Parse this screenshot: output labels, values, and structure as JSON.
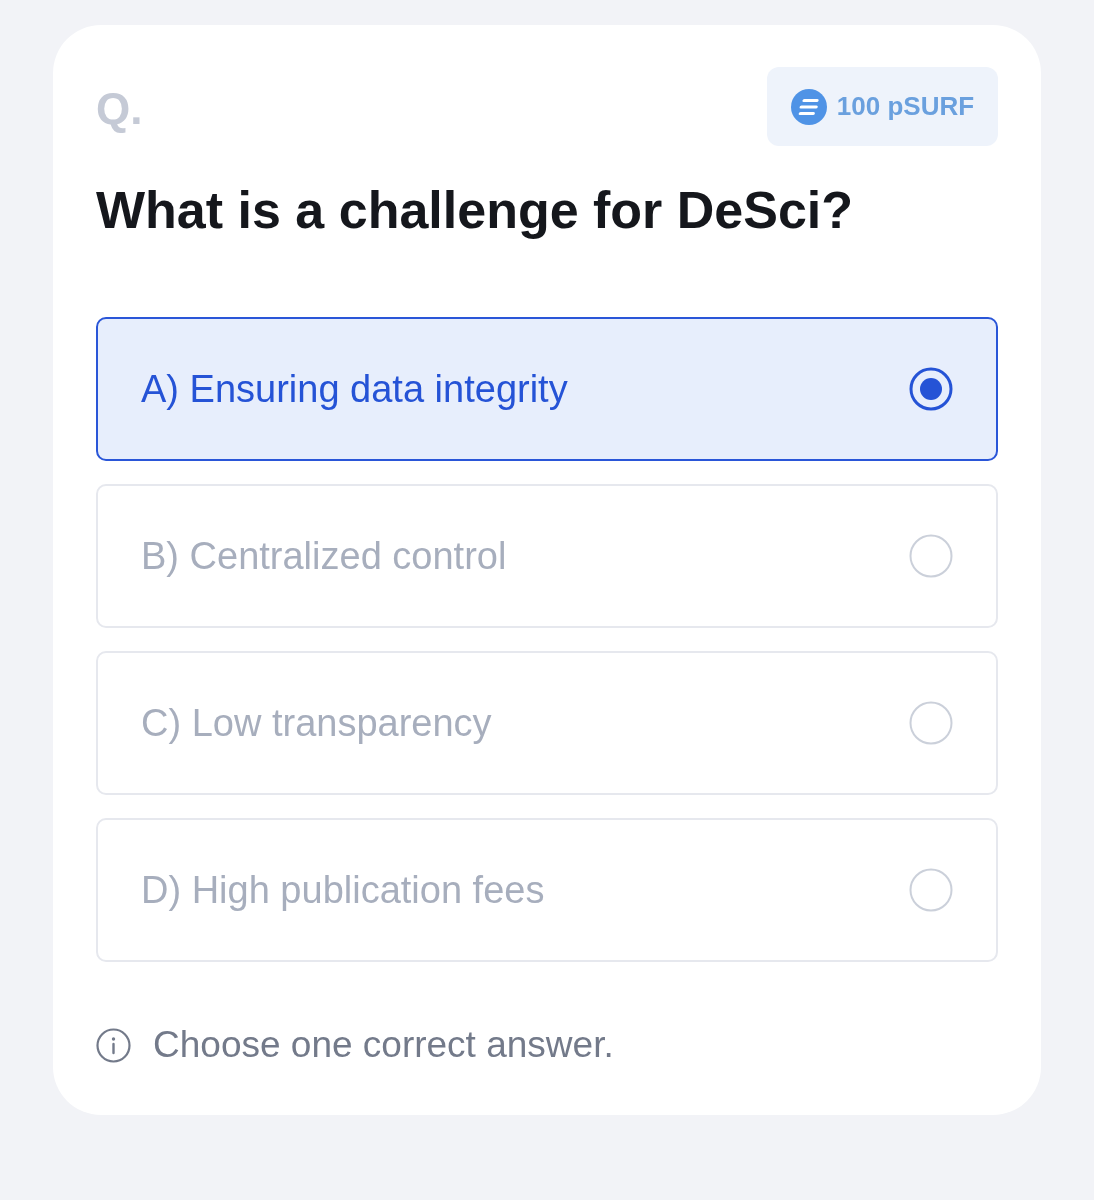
{
  "card": {
    "label": "Q.",
    "reward": {
      "amount": "100 pSURF"
    },
    "question": "What is a challenge for DeSci?",
    "options": [
      {
        "label": "A) Ensuring data integrity",
        "selected": true
      },
      {
        "label": "B) Centralized control",
        "selected": false
      },
      {
        "label": "C) Low transparency",
        "selected": false
      },
      {
        "label": "D) High publication fees",
        "selected": false
      }
    ],
    "hint": "Choose one correct answer."
  }
}
